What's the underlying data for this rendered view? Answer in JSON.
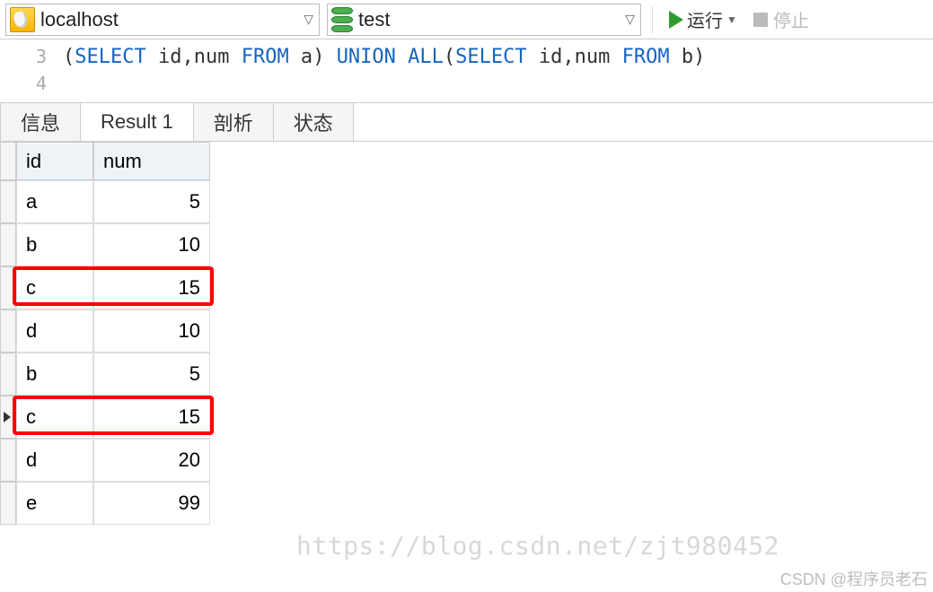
{
  "toolbar": {
    "connection": "localhost",
    "database": "test",
    "run_label": "运行",
    "stop_label": "停止"
  },
  "sql": {
    "line_numbers": [
      "3",
      "4"
    ],
    "tokens": [
      {
        "t": "(",
        "cls": "punc"
      },
      {
        "t": "SELECT",
        "cls": "kw"
      },
      {
        "t": " id,num ",
        "cls": ""
      },
      {
        "t": "FROM",
        "cls": "kw"
      },
      {
        "t": " a",
        "cls": ""
      },
      {
        "t": ") ",
        "cls": "punc"
      },
      {
        "t": "UNION",
        "cls": "kw"
      },
      {
        "t": " ",
        "cls": ""
      },
      {
        "t": "ALL",
        "cls": "kw"
      },
      {
        "t": "(",
        "cls": "punc"
      },
      {
        "t": "SELECT",
        "cls": "kw"
      },
      {
        "t": " id,num ",
        "cls": ""
      },
      {
        "t": "FROM",
        "cls": "kw"
      },
      {
        "t": " b",
        "cls": ""
      },
      {
        "t": ")",
        "cls": "punc"
      }
    ]
  },
  "tabs": {
    "info": "信息",
    "result": "Result 1",
    "profile": "剖析",
    "status": "状态",
    "active": "result"
  },
  "grid": {
    "columns": [
      "id",
      "num"
    ],
    "rows": [
      {
        "id": "a",
        "num": "5",
        "highlight": false,
        "current": false
      },
      {
        "id": "b",
        "num": "10",
        "highlight": false,
        "current": false
      },
      {
        "id": "c",
        "num": "15",
        "highlight": true,
        "current": false
      },
      {
        "id": "d",
        "num": "10",
        "highlight": false,
        "current": false
      },
      {
        "id": "b",
        "num": "5",
        "highlight": false,
        "current": false
      },
      {
        "id": "c",
        "num": "15",
        "highlight": true,
        "current": true
      },
      {
        "id": "d",
        "num": "20",
        "highlight": false,
        "current": false
      },
      {
        "id": "e",
        "num": "99",
        "highlight": false,
        "current": false
      }
    ]
  },
  "watermarks": {
    "url": "https://blog.csdn.net/zjt980452",
    "credit": "CSDN @程序员老石"
  }
}
